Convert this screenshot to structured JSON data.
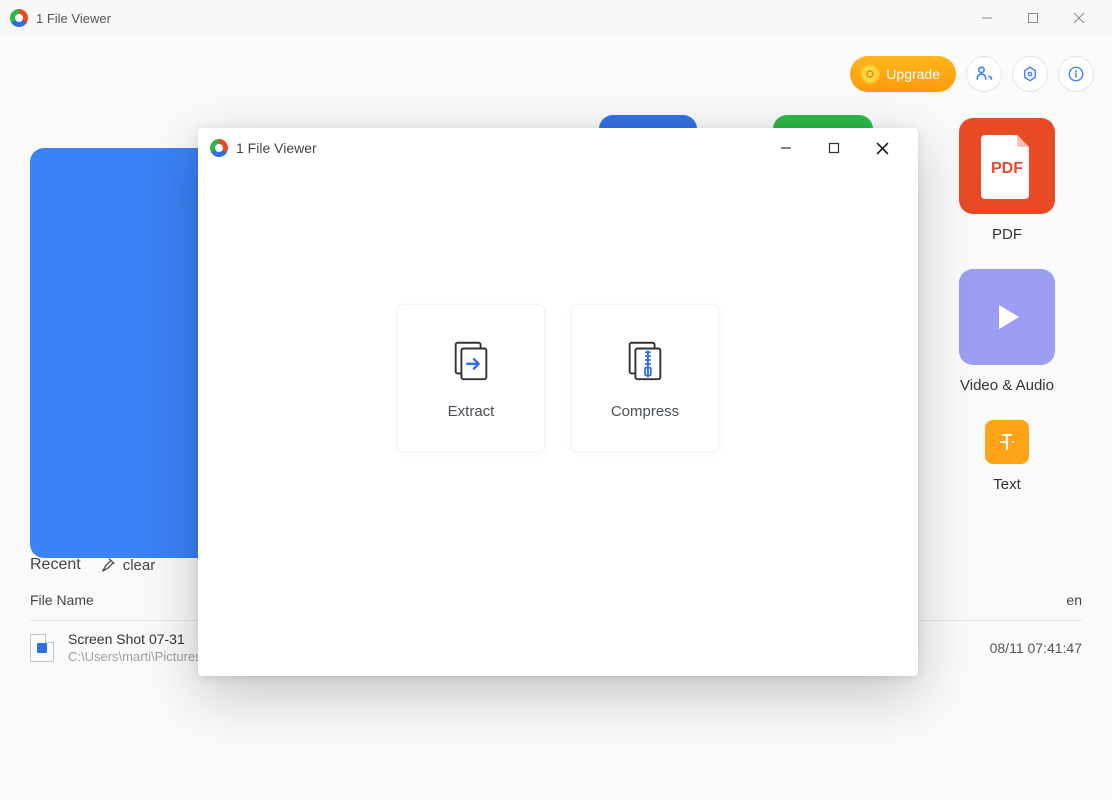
{
  "app": {
    "title": "1 File Viewer"
  },
  "topbar": {
    "upgrade_label": "Upgrade"
  },
  "categories": {
    "pdf": {
      "label": "PDF",
      "badge": "PDF"
    },
    "video_audio": {
      "label": "Video & Audio"
    },
    "text": {
      "label": "Text"
    }
  },
  "recent": {
    "title": "Recent",
    "clear_label": "clear",
    "columns": {
      "name": "File Name",
      "date_suffix": "en"
    },
    "items": [
      {
        "name": "Screen Shot 07-31",
        "path": "C:\\Users\\marti\\Pictures\\My Screen Shots",
        "date": "08/11 07:41:47"
      }
    ]
  },
  "dialog": {
    "title": "1 File Viewer",
    "actions": {
      "extract": "Extract",
      "compress": "Compress"
    }
  }
}
